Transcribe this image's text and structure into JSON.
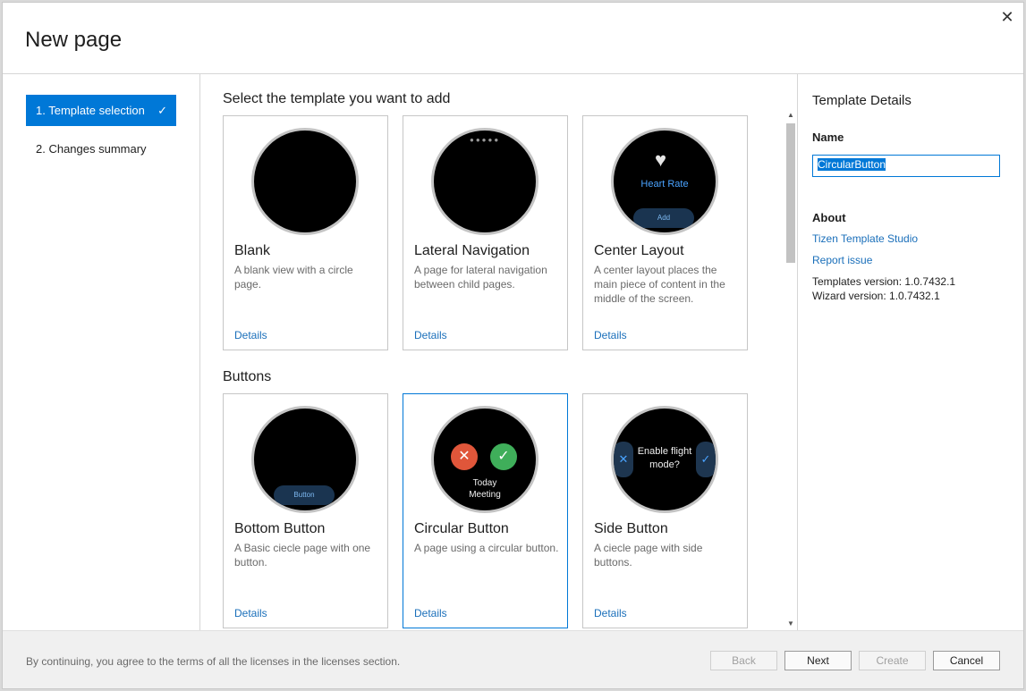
{
  "dialog": {
    "title": "New page",
    "close_icon": "close-icon"
  },
  "steps": [
    {
      "label": "1. Template selection",
      "active": true,
      "check": "✓"
    },
    {
      "label": "2. Changes summary",
      "active": false
    }
  ],
  "content": {
    "section1_title": "Select the template you want to add",
    "section2_title": "Buttons",
    "details_link": "Details",
    "cards": [
      {
        "title": "Blank",
        "desc": "A blank view with a circle page."
      },
      {
        "title": "Lateral Navigation",
        "desc": "A page for lateral navigation between child pages."
      },
      {
        "title": "Center Layout",
        "desc": "A center layout places the main piece of content in the middle of the screen.",
        "watch_label": "Heart Rate",
        "watch_button": "Add"
      },
      {
        "title": "Bottom Button",
        "desc": "A Basic ciecle page with one button.",
        "watch_button": "Button"
      },
      {
        "title": "Circular Button",
        "desc": "A page using a circular button.",
        "selected": true,
        "watch_text_1": "Today",
        "watch_text_2": "Meeting"
      },
      {
        "title": "Side Button",
        "desc": "A ciecle page with side buttons.",
        "watch_text_1": "Enable flight",
        "watch_text_2": "mode?"
      }
    ]
  },
  "details": {
    "title": "Template Details",
    "name_label": "Name",
    "name_value": "CircularButton",
    "about_label": "About",
    "link_studio": "Tizen Template Studio",
    "link_report": "Report issue",
    "templates_version": "Templates version: 1.0.7432.1",
    "wizard_version": "Wizard version: 1.0.7432.1"
  },
  "footer": {
    "note": "By continuing, you agree to the terms of all the licenses in the licenses section.",
    "back": "Back",
    "next": "Next",
    "create": "Create",
    "cancel": "Cancel"
  },
  "colors": {
    "accent": "#0078d7",
    "link": "#1a6fba",
    "cancel_red": "#e0563a",
    "confirm_green": "#3fae5a"
  }
}
